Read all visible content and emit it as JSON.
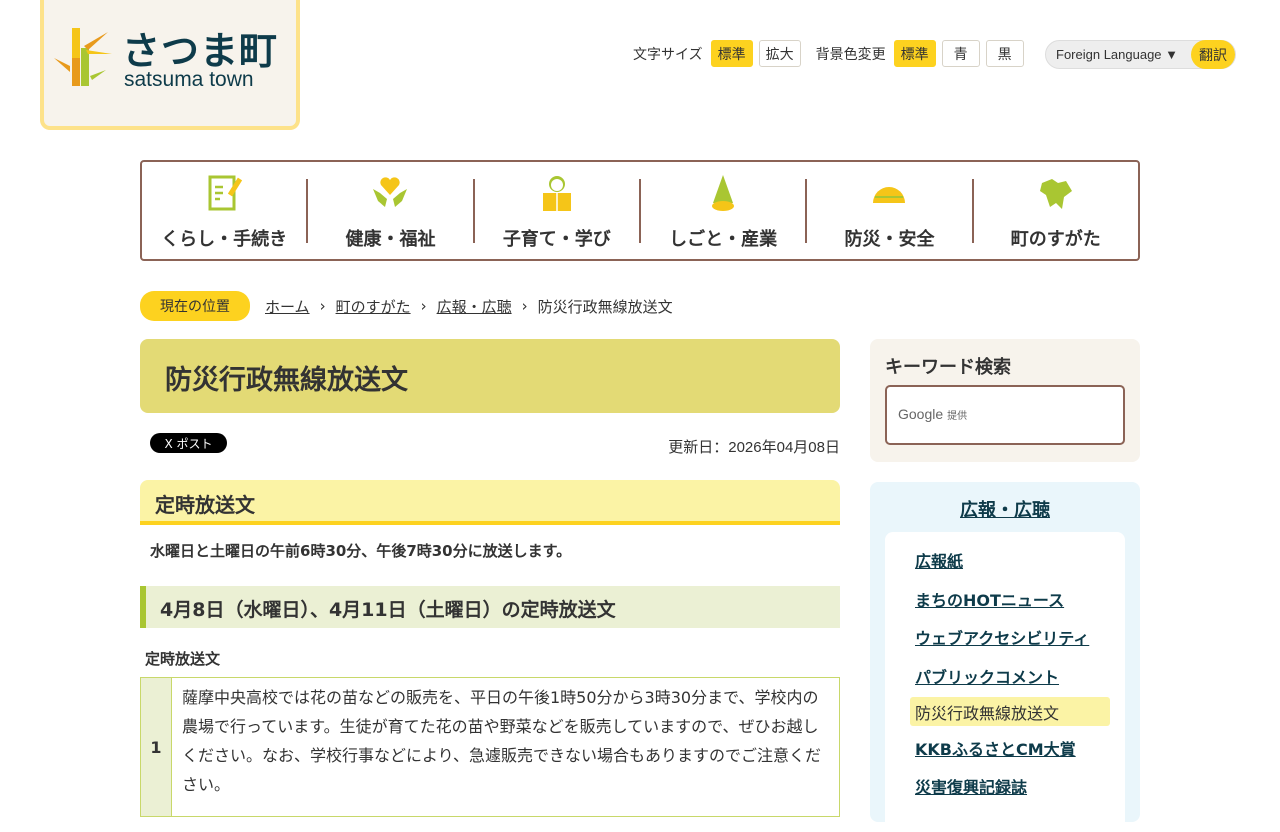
{
  "logo": {
    "jp": "さつま町",
    "en": "satsuma town"
  },
  "tools": {
    "font_size_label": "文字サイズ",
    "font_standard": "標準",
    "font_large": "拡大",
    "bg_label": "背景色変更",
    "bg_standard": "標準",
    "bg_blue": "青",
    "bg_black": "黒",
    "lang_select": "Foreign Language ▼",
    "translate": "翻訳"
  },
  "gnav": [
    {
      "label": "くらし・手続き",
      "icon": "document-pen-icon"
    },
    {
      "label": "健康・福祉",
      "icon": "hands-heart-icon"
    },
    {
      "label": "子育て・学び",
      "icon": "child-book-icon"
    },
    {
      "label": "しごと・産業",
      "icon": "bamboo-shoot-icon"
    },
    {
      "label": "防災・安全",
      "icon": "helmet-icon"
    },
    {
      "label": "町のすがた",
      "icon": "town-map-icon"
    }
  ],
  "breadcrumb": {
    "here": "現在の位置",
    "items": [
      "ホーム",
      "町のすがた",
      "広報・広聴"
    ],
    "current": "防災行政無線放送文"
  },
  "page": {
    "title": "防災行政無線放送文",
    "x_post": "X ポスト",
    "updated": "更新日：2026年04月08日",
    "h2": "定時放送文",
    "intro": "水曜日と土曜日の午前6時30分、午後7時30分に放送します。",
    "h3": "4月8日（水曜日）、4月11日（土曜日）の定時放送文",
    "h4": "定時放送文",
    "rows": [
      {
        "num": "1",
        "text": "薩摩中央高校では花の苗などの販売を、平日の午後1時50分から3時30分まで、学校内の農場で行っています。生徒が育てた花の苗や野菜などを販売していますので、ぜひお越しください。なお、学校行事などにより、急遽販売できない場合もありますのでご注意ください。"
      }
    ]
  },
  "search": {
    "title": "キーワード検索",
    "google": "Google",
    "provided": "提供"
  },
  "sidemenu": {
    "title": "広報・広聴",
    "items": [
      "広報紙",
      "まちのHOTニュース",
      "ウェブアクセシビリティ",
      "パブリックコメント",
      "防災行政無線放送文",
      "KKBふるさとCM大賞",
      "災害復興記録誌"
    ]
  }
}
